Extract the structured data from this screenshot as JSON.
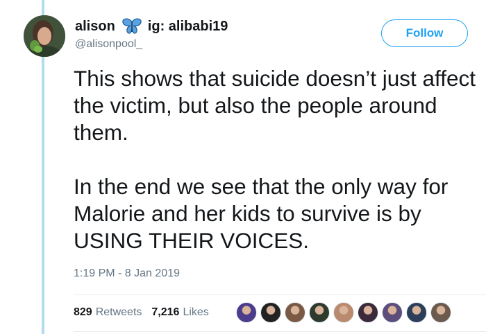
{
  "user": {
    "display_name": "alison",
    "display_name_suffix": "ig: alibabi19",
    "handle": "@alisonpool_",
    "emoji_icon": "butterfly-icon"
  },
  "follow_label": "Follow",
  "tweet": {
    "paragraph_1": "This shows that suicide doesn’t just affect the victim, but also the people around them.",
    "paragraph_2": "In the end we see that the only way for Malorie and her kids to survive is by USING THEIR VOICES.",
    "timestamp": "1:19 PM - 8 Jan 2019"
  },
  "stats": {
    "retweets_count": "829",
    "retweets_label": "Retweets",
    "likes_count": "7,216",
    "likes_label": "Likes"
  },
  "liker_avatars": [
    {
      "color": "#4b3c8c"
    },
    {
      "color": "#222222"
    },
    {
      "color": "#7a5a45"
    },
    {
      "color": "#2f3a2e"
    },
    {
      "color": "#b98a6e"
    },
    {
      "color": "#3b2a3a"
    },
    {
      "color": "#5d4d7a"
    },
    {
      "color": "#2c3e5a"
    },
    {
      "color": "#6b5a4d"
    }
  ],
  "colors": {
    "accent": "#1da1f2",
    "text_primary": "#14171a",
    "text_secondary": "#657786",
    "thread_line": "#b0dcf0"
  }
}
